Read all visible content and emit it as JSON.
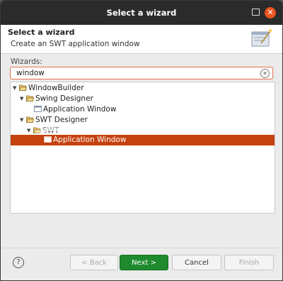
{
  "window": {
    "title": "Select a wizard"
  },
  "header": {
    "title": "Select a wizard",
    "subtitle": "Create an SWT application window"
  },
  "wizards_label": "Wizards:",
  "filter": {
    "value": "window"
  },
  "tree": {
    "windowbuilder": "WindowBuilder",
    "swing_designer": "Swing Designer",
    "swing_app_window": "Application Window",
    "swt_designer": "SWT Designer",
    "swt": "SWT",
    "swt_app_window": "Application Window"
  },
  "buttons": {
    "help": "?",
    "back": "< Back",
    "next": "Next >",
    "cancel": "Cancel",
    "finish": "Finish"
  },
  "colors": {
    "accent": "#e95420",
    "selection": "#c4420f",
    "next": "#1e8a2e"
  }
}
